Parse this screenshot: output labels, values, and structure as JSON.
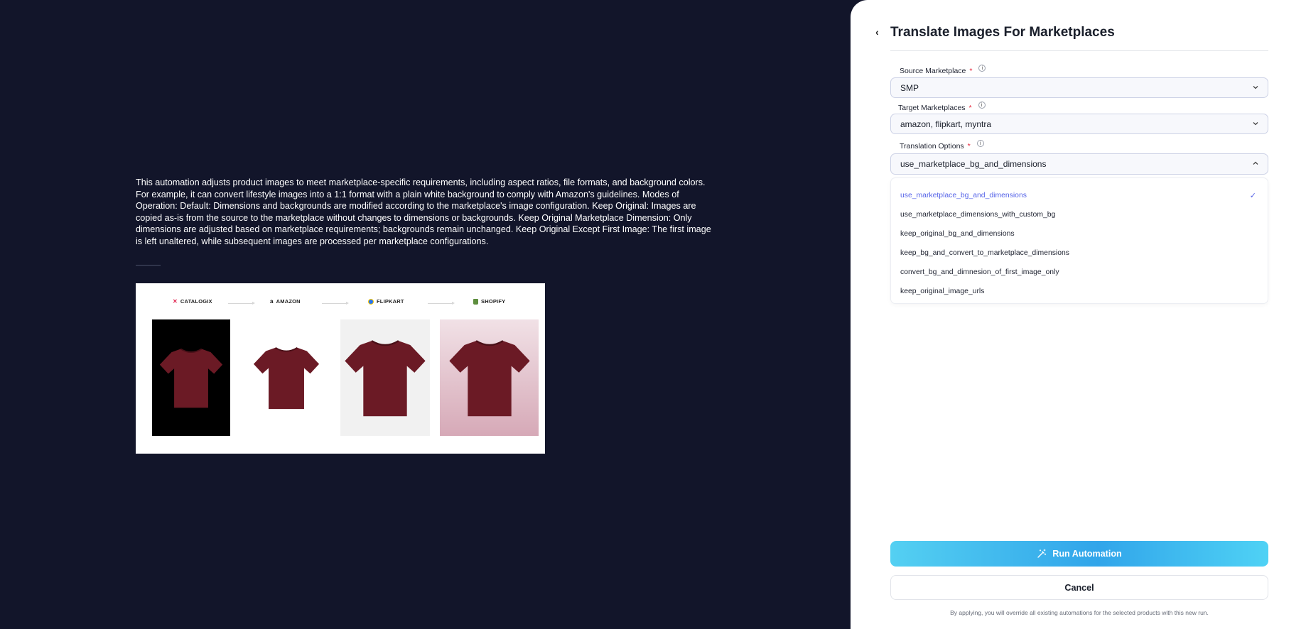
{
  "description": "This automation adjusts product images to meet marketplace-specific requirements, including aspect ratios, file formats, and background colors. For example, it can convert lifestyle images into a 1:1 format with a plain white background to comply with Amazon's guidelines. Modes of Operation: Default: Dimensions and backgrounds are modified according to the marketplace's image configuration. Keep Original: Images are copied as-is from the source to the marketplace without changes to dimensions or backgrounds. Keep Original Marketplace Dimension: Only dimensions are adjusted based on marketplace requirements; backgrounds remain unchanged. Keep Original Except First Image: The first image is left unaltered, while subsequent images are processed per marketplace configurations.",
  "preview": {
    "brands": [
      "CATALOGIX",
      "AMAZON",
      "FLIPKART",
      "SHOPIFY"
    ],
    "tshirt_color": "#6b1a25"
  },
  "panel": {
    "title": "Translate Images For Marketplaces",
    "source": {
      "label": "Source Marketplace",
      "value": "SMP"
    },
    "target": {
      "label": "Target Marketplaces",
      "value": "amazon, flipkart, myntra"
    },
    "translation": {
      "label": "Translation Options",
      "value": "use_marketplace_bg_and_dimensions",
      "options": [
        "use_marketplace_bg_and_dimensions",
        "use_marketplace_dimensions_with_custom_bg",
        "keep_original_bg_and_dimensions",
        "keep_bg_and_convert_to_marketplace_dimensions",
        "convert_bg_and_dimnesion_of_first_image_only",
        "keep_original_image_urls"
      ]
    },
    "required_mark": "*",
    "info_mark": "i",
    "run_label": "Run Automation",
    "cancel_label": "Cancel",
    "footnote": "By applying, you will override all existing automations for the selected products with this new run."
  },
  "colors": {
    "background": "#12152a",
    "accent": "#5563e8",
    "run_gradient_start": "#54d0f2",
    "run_gradient_mid": "#31a5ea"
  }
}
